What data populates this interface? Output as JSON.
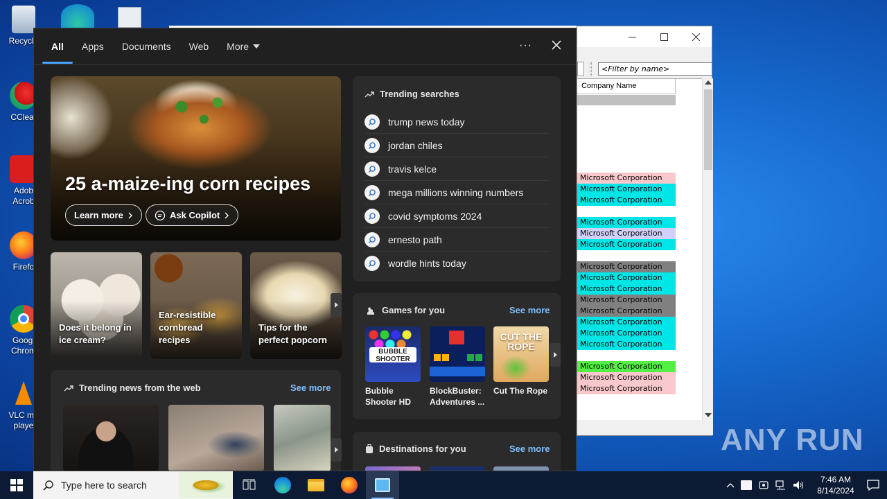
{
  "desktop": {
    "icons": [
      {
        "label": "Recycle",
        "icon": "recycle-bin-icon"
      },
      {
        "label": "CClear",
        "icon": "ccleaner-icon"
      },
      {
        "label": "Adob Acrob",
        "icon": "acrobat-icon"
      },
      {
        "label": "Firefo",
        "icon": "firefox-icon"
      },
      {
        "label": "Googl Chrom",
        "icon": "chrome-icon"
      },
      {
        "label": "VLC me playe",
        "icon": "vlc-icon"
      }
    ]
  },
  "bg_window": {
    "filter_placeholder": "<Filter by name>",
    "column_header": "Company Name",
    "rows": [
      {
        "text": "Microsoft Corporation",
        "color": "#f8c8cc"
      },
      {
        "text": "Microsoft Corporation",
        "color": "#00e5e5"
      },
      {
        "text": "Microsoft Corporation",
        "color": "#00e5e5"
      },
      {
        "text": "Microsoft Corporation",
        "color": "#00e5e5"
      },
      {
        "text": "Microsoft Corporation",
        "color": "#d0d0f8"
      },
      {
        "text": "Microsoft Corporation",
        "color": "#00e5e5"
      },
      {
        "text": "Microsoft Corporation",
        "color": "#808080"
      },
      {
        "text": "Microsoft Corporation",
        "color": "#00e5e5"
      },
      {
        "text": "Microsoft Corporation",
        "color": "#00e5e5"
      },
      {
        "text": "Microsoft Corporation",
        "color": "#808080"
      },
      {
        "text": "Microsoft Corporation",
        "color": "#808080"
      },
      {
        "text": "Microsoft Corporation",
        "color": "#00e5e5"
      },
      {
        "text": "Microsoft Corporation",
        "color": "#00e5e5"
      },
      {
        "text": "Microsoft Corporation",
        "color": "#00e5e5"
      },
      {
        "text": "Microsoft Corporation",
        "color": "#55ee44"
      },
      {
        "text": "Microsoft Corporation",
        "color": "#f8c8cc"
      },
      {
        "text": "Microsoft Corporation",
        "color": "#f8c8cc"
      }
    ]
  },
  "search": {
    "tabs": [
      {
        "label": "All",
        "active": true
      },
      {
        "label": "Apps"
      },
      {
        "label": "Documents"
      },
      {
        "label": "Web"
      },
      {
        "label": "More"
      }
    ],
    "more_options": "···",
    "hero": {
      "title": "25 a-maize-ing corn recipes",
      "learn_more": "Learn more",
      "ask_copilot": "Ask Copilot"
    },
    "cards": [
      {
        "caption": "Does it belong in ice cream?"
      },
      {
        "caption": "Ear-resistible cornbread recipes"
      },
      {
        "caption": "Tips for the perfect popcorn"
      }
    ],
    "trending": {
      "title": "Trending searches",
      "items": [
        "trump news today",
        "jordan chiles",
        "travis kelce",
        "mega millions winning numbers",
        "covid symptoms 2024",
        "ernesto path",
        "wordle hints today"
      ]
    },
    "games": {
      "title": "Games for you",
      "see_more": "See more",
      "items": [
        {
          "name": "Bubble Shooter HD",
          "logo": "BUBBLE SHOOTER"
        },
        {
          "name": "BlockBuster: Adventures ..."
        },
        {
          "name": "Cut The Rope",
          "logo": "CUT THE ROPE"
        }
      ]
    },
    "news": {
      "title": "Trending news from the web",
      "see_more": "See more"
    },
    "destinations": {
      "title": "Destinations for you",
      "see_more": "See more"
    }
  },
  "taskbar": {
    "search_placeholder": "Type here to search",
    "time": "7:46 AM",
    "date": "8/14/2024"
  },
  "watermark": "ANY RUN"
}
